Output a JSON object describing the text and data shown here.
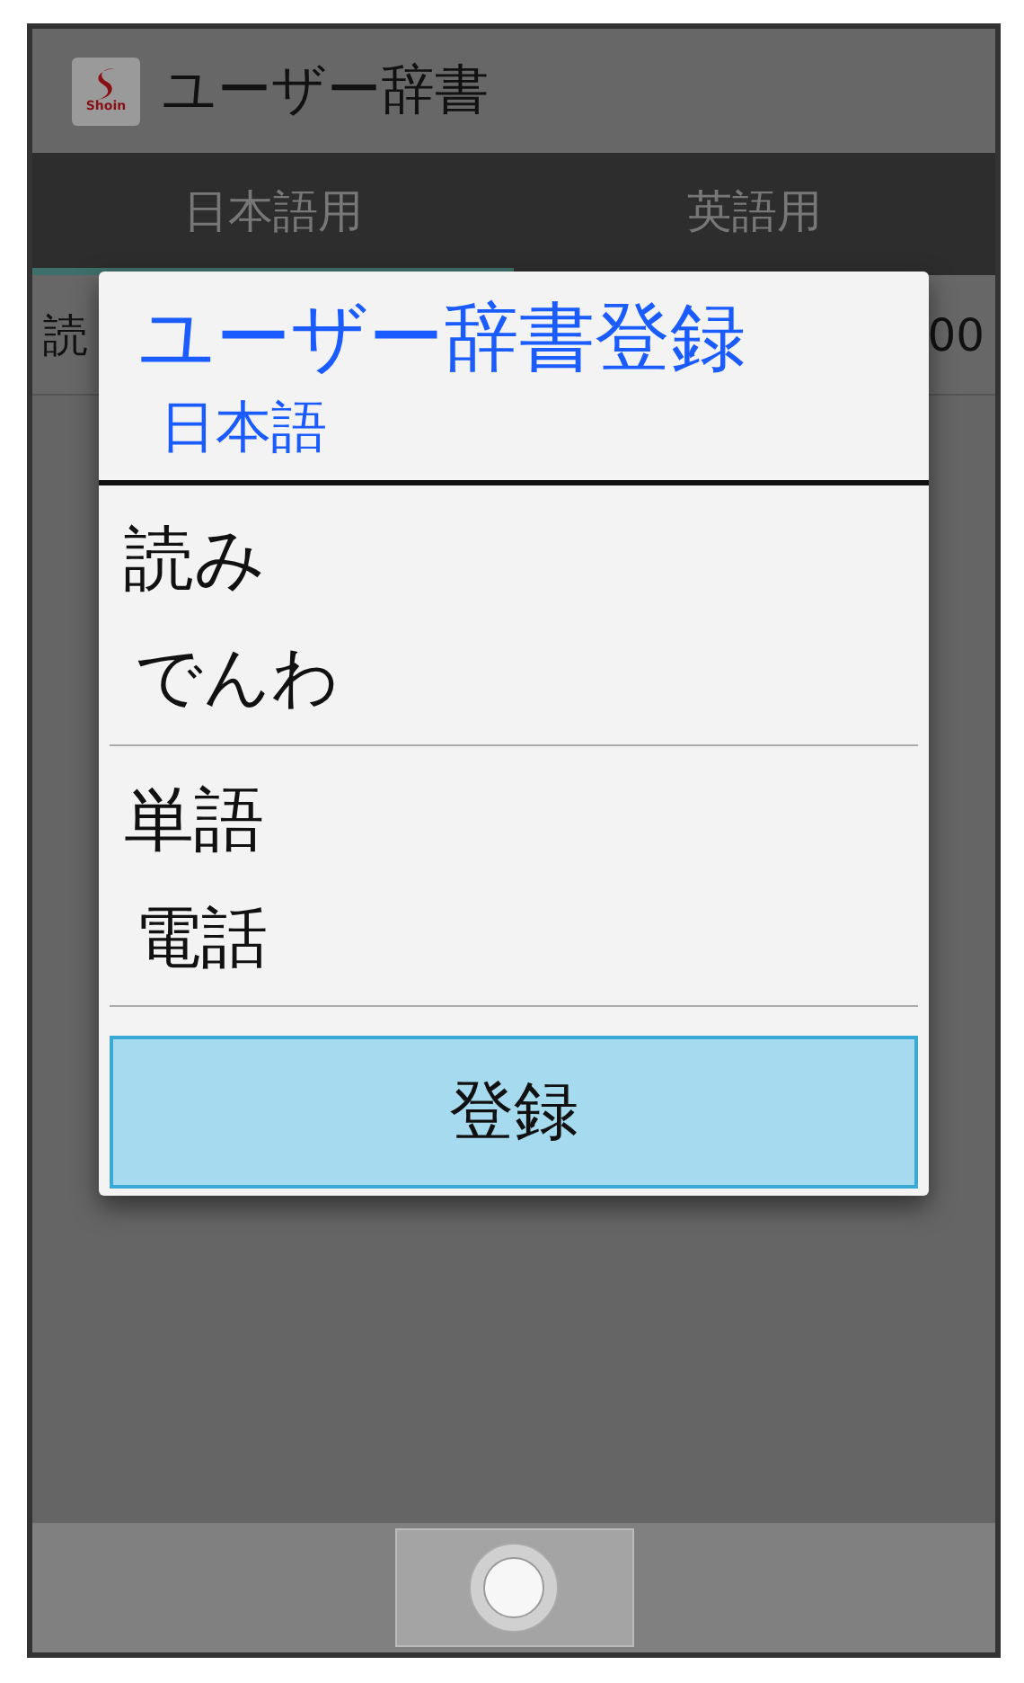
{
  "app_bar": {
    "title": "ユーザー辞書",
    "logo_text": "Shoin"
  },
  "tabs": [
    {
      "label": "日本語用",
      "selected": true
    },
    {
      "label": "英語用",
      "selected": false
    }
  ],
  "list_header": {
    "column_1": "読",
    "column_2": "00"
  },
  "dialog": {
    "title": "ユーザー辞書登録",
    "subtitle": "日本語",
    "fields": [
      {
        "label": "読み",
        "value": "でんわ"
      },
      {
        "label": "単語",
        "value": "電話"
      }
    ],
    "button": "登録"
  }
}
